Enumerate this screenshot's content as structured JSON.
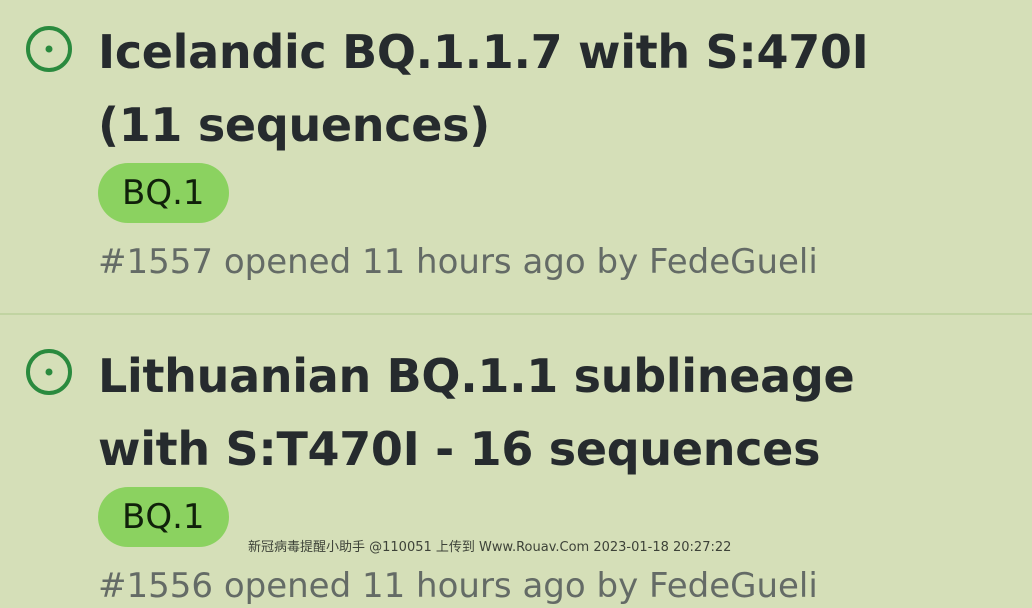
{
  "issues": [
    {
      "title": "Icelandic BQ.1.1.7 with S:470I (11 sequences)",
      "label": "BQ.1",
      "number": "#1557",
      "opened_text": "opened 11 hours ago by",
      "author": "FedeGueli"
    },
    {
      "title": "Lithuanian BQ.1.1 sublineage with S:T470I - 16 sequences",
      "label": "BQ.1",
      "number": "#1556",
      "opened_text": "opened 11 hours ago by",
      "author": "FedeGueli"
    }
  ],
  "icons": {
    "status": "issue-opened-icon"
  },
  "colors": {
    "background": "#d5dfb8",
    "open_icon": "#2a8a3e",
    "label_bg": "#8bd260",
    "title": "#262b2e",
    "meta": "#646b66"
  },
  "watermark": "新冠病毒提醒小助手 @110051 上传到 Www.Rouav.Com 2023-01-18 20:27:22"
}
